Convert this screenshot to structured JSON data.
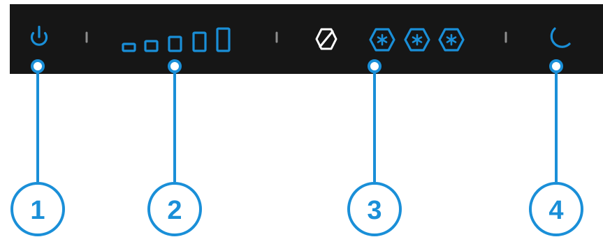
{
  "colors": {
    "accent": "#1a8fd8",
    "panel": "#161616",
    "separator": "#8e8e8e",
    "background": "#ffffff"
  },
  "controls": [
    {
      "id": "power",
      "icon": "power-icon"
    },
    {
      "id": "fan-speed",
      "icon": "fan-speed-bars-icon",
      "levels": 5
    },
    {
      "id": "cooling-off",
      "icon": "cooling-off-icon"
    },
    {
      "id": "cooling-mode",
      "icon": "snowflake-hexagon-icon",
      "count": 3
    },
    {
      "id": "night-mode",
      "icon": "moon-icon"
    }
  ],
  "callouts": [
    {
      "label": "1"
    },
    {
      "label": "2"
    },
    {
      "label": "3"
    },
    {
      "label": "4"
    }
  ]
}
